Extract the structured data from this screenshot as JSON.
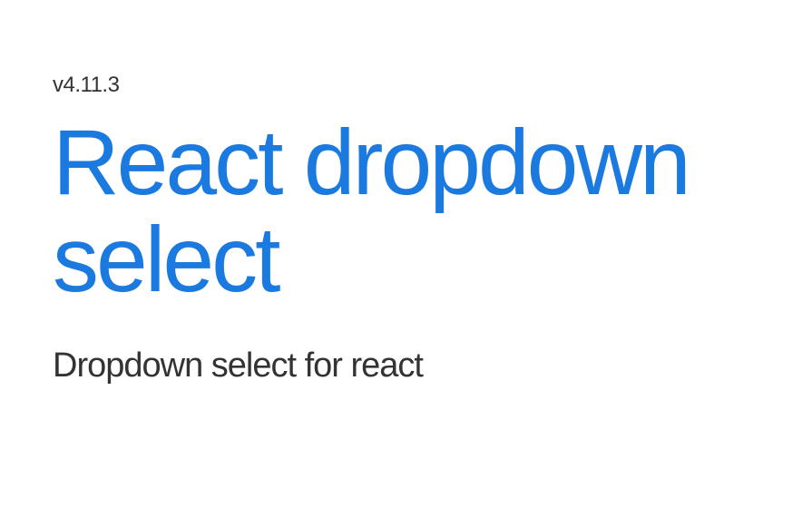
{
  "version": "v4.11.3",
  "title": "React dropdown select",
  "subtitle": "Dropdown select for react"
}
